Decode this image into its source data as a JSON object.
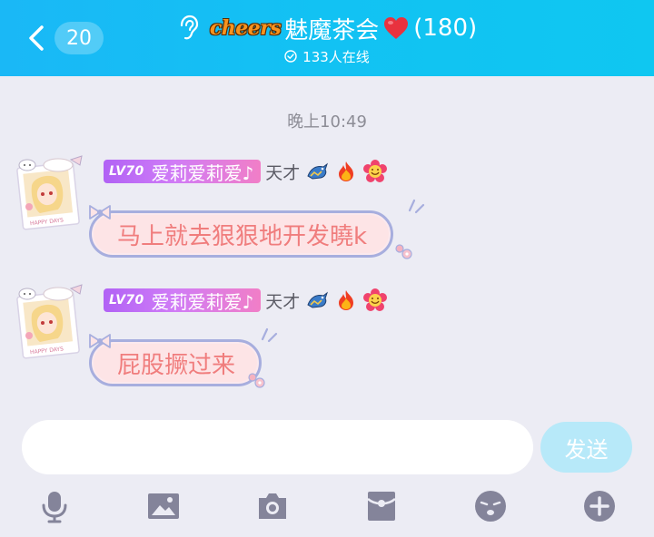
{
  "header": {
    "back_count": "20",
    "brand_logo": "cheers",
    "group_name": "魅魔茶会",
    "member_count": "(180)",
    "online_text": "133人在线"
  },
  "chat": {
    "timestamp": "晚上10:49",
    "messages": [
      {
        "level": "LV70",
        "nickname": "爱莉爱莉爱♪",
        "title_badge": "天才",
        "text": "马上就去狠狠地开发曉k"
      },
      {
        "level": "LV70",
        "nickname": "爱莉爱莉爱♪",
        "title_badge": "天才",
        "text": "屁股撅过来"
      }
    ]
  },
  "input": {
    "placeholder": "",
    "send_label": "发送"
  },
  "toolbar": {
    "icons": [
      "microphone-icon",
      "image-icon",
      "camera-icon",
      "red-packet-icon",
      "emoji-icon",
      "plus-icon"
    ]
  },
  "colors": {
    "header_gradient_start": "#1ab8f6",
    "header_gradient_end": "#0fc7f1",
    "background": "#ececf4",
    "bubble_fill": "#fde4e6",
    "bubble_text": "#f07d7d",
    "bubble_border": "#a7aede",
    "send_button": "#b7e9f9",
    "toolbar_icon": "#84849a"
  }
}
